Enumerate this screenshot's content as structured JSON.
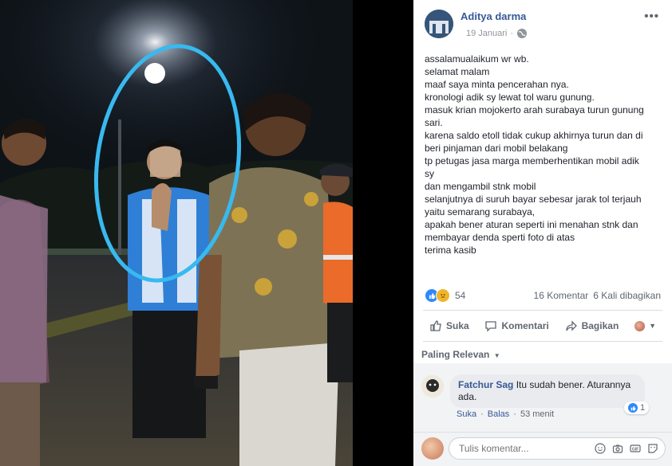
{
  "post": {
    "author": "Aditya darma",
    "date": "19 Januari",
    "privacy_icon": "globe-icon",
    "lines": [
      "assalamualaikum wr wb.",
      "selamat malam",
      "maaf saya minta pencerahan nya.",
      "kronologi adik sy lewat tol waru gunung.",
      "masuk krian mojokerto arah surabaya turun gunung",
      "sari.",
      "karena saldo etoll tidak cukup akhirnya turun dan di",
      "beri pinjaman dari mobil belakang",
      "tp petugas jasa marga memberhentikan mobil adik",
      "sy",
      "dan mengambil stnk mobil",
      "selanjutnya di suruh bayar sebesar jarak tol terjauh",
      "yaitu semarang surabaya,",
      "apakah bener aturan seperti ini menahan stnk dan",
      "membayar denda sperti foto di atas",
      "terima kasib"
    ],
    "reaction_count": "54",
    "comment_count": "16 Komentar",
    "share_count": "6 Kali dibagikan"
  },
  "actions": {
    "like": "Suka",
    "comment": "Komentari",
    "share": "Bagikan"
  },
  "comments": {
    "sort_label": "Paling Relevan",
    "items": [
      {
        "name": "Fatchur Sag",
        "text": "Itu sudah bener. Aturannya ada.",
        "like_label": "Suka",
        "reply_label": "Balas",
        "time": "53 menit",
        "reaction_count": "1"
      }
    ],
    "composer_placeholder": "Tulis komentar..."
  },
  "colors": {
    "link": "#385898",
    "like_blue": "#2d88ff",
    "circle_highlight": "#38b9f0"
  }
}
